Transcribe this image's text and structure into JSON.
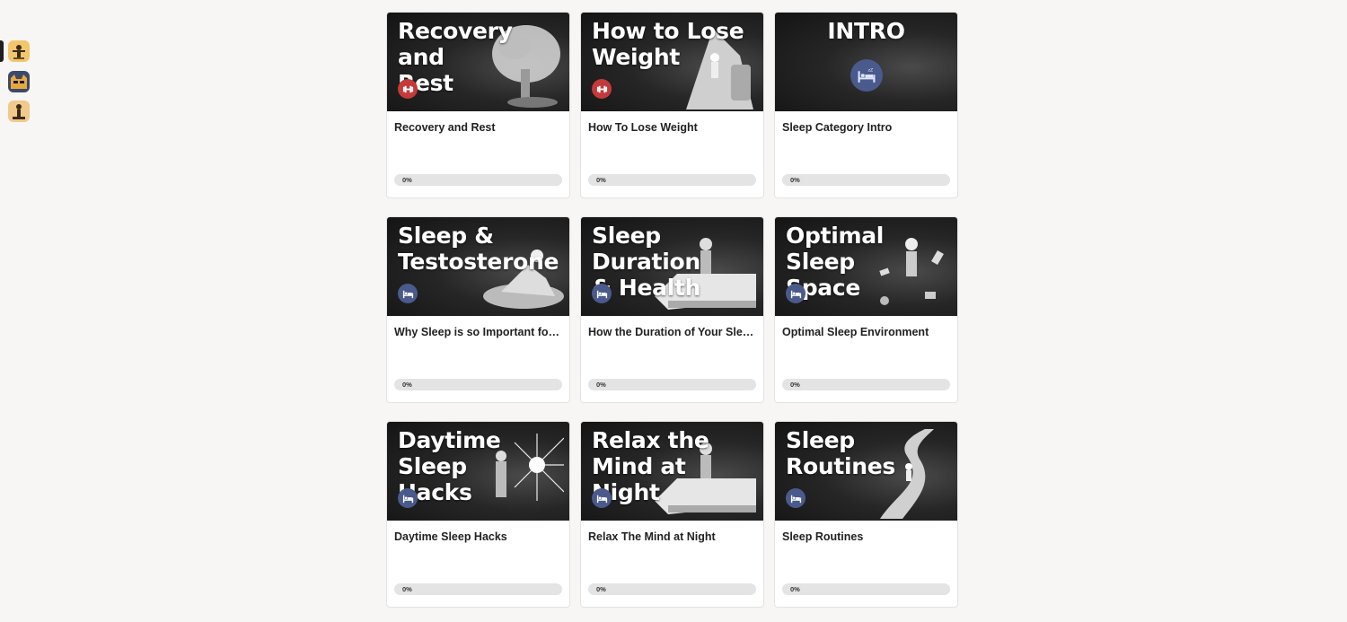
{
  "sidebar": {
    "items": [
      {
        "name": "avatar-workout",
        "active": true
      },
      {
        "name": "avatar-cat",
        "active": false
      },
      {
        "name": "avatar-lifter",
        "active": false
      }
    ]
  },
  "colors": {
    "fitness_badge": "#c43a3a",
    "sleep_badge": "#4a5a8c",
    "thumb_bg": "#1c1c1c",
    "page_bg": "#f7f6f4"
  },
  "courses": [
    {
      "thumb_title": "Recovery and\nRest",
      "title": "Recovery and Rest",
      "progress": "0%",
      "progress_value": 0,
      "badge": "dumbbell-icon",
      "art": "tree"
    },
    {
      "thumb_title": "How to Lose\nWeight",
      "title": "How To Lose Weight",
      "progress": "0%",
      "progress_value": 0,
      "badge": "dumbbell-icon",
      "art": "climber"
    },
    {
      "thumb_title": "INTRO",
      "title": "Sleep Category Intro",
      "progress": "0%",
      "progress_value": 0,
      "badge": "bed-icon",
      "art": "none"
    },
    {
      "thumb_title": "Sleep &\nTestosterone",
      "title": "Why Sleep is so Important for Testosterone",
      "progress": "0%",
      "progress_value": 0,
      "badge": "bed-icon",
      "art": "sleeper"
    },
    {
      "thumb_title": "Sleep Duration\n& Health",
      "title": "How the Duration of Your Sleep Affects Your Health",
      "progress": "0%",
      "progress_value": 0,
      "badge": "bed-icon",
      "art": "bed"
    },
    {
      "thumb_title": "Optimal Sleep\nSpace",
      "title": "Optimal Sleep Environment",
      "progress": "0%",
      "progress_value": 0,
      "badge": "bed-icon",
      "art": "floating"
    },
    {
      "thumb_title": "Daytime\nSleep\n      Hacks",
      "title": "Daytime Sleep Hacks",
      "progress": "0%",
      "progress_value": 0,
      "badge": "bed-icon",
      "art": "sun"
    },
    {
      "thumb_title": "Relax the\nMind at Night",
      "title": "Relax The Mind at Night",
      "progress": "0%",
      "progress_value": 0,
      "badge": "bed-icon",
      "art": "bed"
    },
    {
      "thumb_title": "Sleep\nRoutines",
      "title": "Sleep Routines",
      "progress": "0%",
      "progress_value": 0,
      "badge": "bed-icon",
      "art": "road"
    }
  ]
}
